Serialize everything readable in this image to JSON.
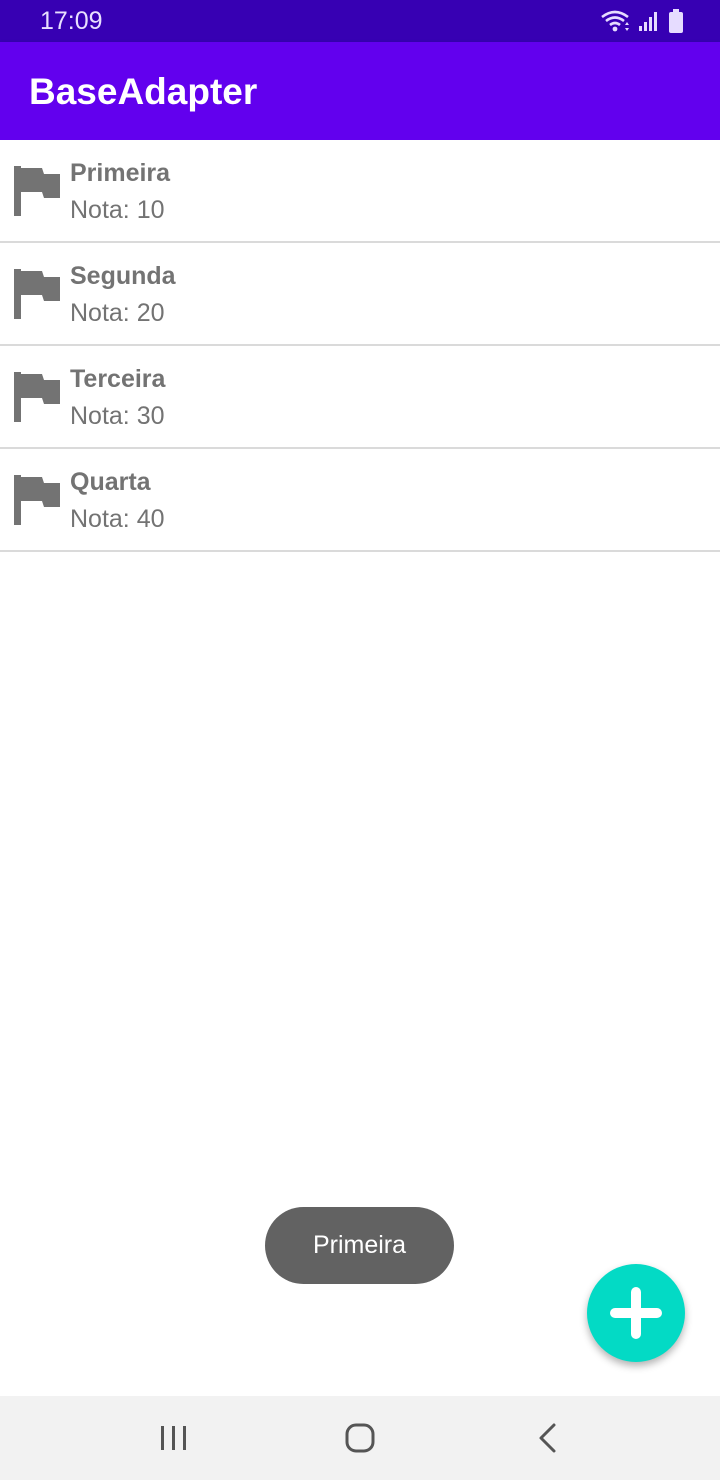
{
  "status_bar": {
    "time": "17:09",
    "icons": [
      "wifi-icon",
      "signal-icon",
      "battery-icon"
    ]
  },
  "app_bar": {
    "title": "BaseAdapter",
    "color": "#6200ee"
  },
  "list": {
    "items": [
      {
        "title": "Primeira",
        "subtitle": "Nota: 10",
        "icon": "flag-icon"
      },
      {
        "title": "Segunda",
        "subtitle": "Nota: 20",
        "icon": "flag-icon"
      },
      {
        "title": "Terceira",
        "subtitle": "Nota: 30",
        "icon": "flag-icon"
      },
      {
        "title": "Quarta",
        "subtitle": "Nota: 40",
        "icon": "flag-icon"
      }
    ]
  },
  "toast": {
    "text": "Primeira"
  },
  "fab": {
    "icon": "plus-icon",
    "color": "#03dac5"
  },
  "nav_bar": {
    "buttons": [
      "recent-apps-icon",
      "home-icon",
      "back-icon"
    ]
  }
}
